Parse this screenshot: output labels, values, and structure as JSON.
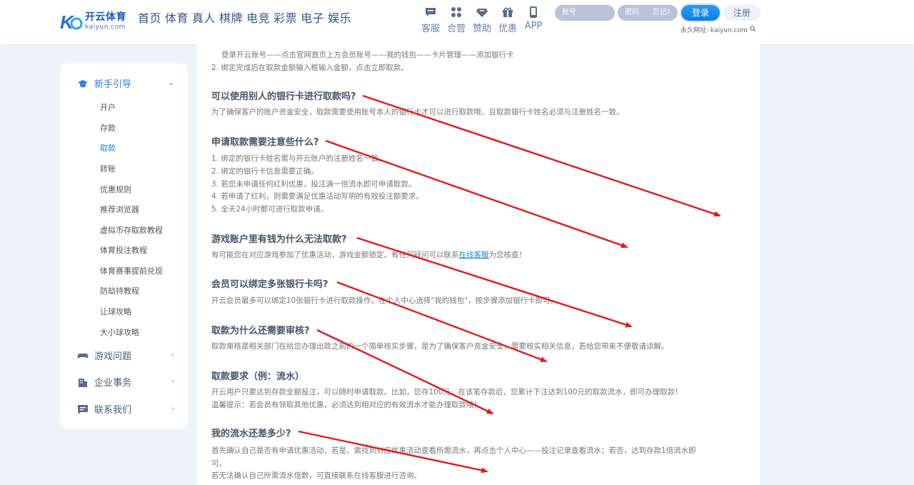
{
  "header": {
    "logo_cn": "开云体育",
    "logo_en": "kaiyun.com",
    "nav": [
      "首页",
      "体育",
      "真人",
      "棋牌",
      "电竞",
      "彩票",
      "电子",
      "娱乐"
    ],
    "quick": [
      {
        "label": "客服",
        "icon": "chat-icon"
      },
      {
        "label": "合营",
        "icon": "grid-icon"
      },
      {
        "label": "赞助",
        "icon": "diamond-icon"
      },
      {
        "label": "优惠",
        "icon": "gift-icon"
      },
      {
        "label": "APP",
        "icon": "phone-icon"
      }
    ],
    "login": {
      "account_placeholder": "账号",
      "password_placeholder": "密码",
      "forgot": "忘记?",
      "login_label": "登录",
      "register_label": "注册",
      "url_text": "永久网址: kaiyun.com"
    }
  },
  "sidebar": {
    "sections": [
      {
        "label": "新手引导",
        "icon": "graduation-cap-icon",
        "expanded": true
      },
      {
        "label": "游戏问题",
        "icon": "gamepad-icon",
        "expanded": false
      },
      {
        "label": "企业事务",
        "icon": "building-icon",
        "expanded": false
      },
      {
        "label": "联系我们",
        "icon": "message-icon",
        "expanded": false
      }
    ],
    "subitems": [
      "开户",
      "存款",
      "取款",
      "转账",
      "优惠规则",
      "推荐浏览器",
      "虚拟币存取款教程",
      "体育投注教程",
      "体育赛事提前兑现",
      "防劫持教程",
      "让球攻略",
      "大小球攻略"
    ],
    "active_subitem": "取款"
  },
  "content": {
    "intro": [
      "登录开云账号——点击官网首页上方会员账号——我的钱包——卡片管理——添加银行卡",
      "2. 绑定完成后在取款金额输入框输入金额，点击立即取款。"
    ],
    "sections": [
      {
        "title": "可以使用别人的银行卡进行取款吗?",
        "lines": [
          "为了确保客户的账户资金安全，取款需要使用账号本人的银行卡才可以进行取款哦，且取款银行卡姓名必须与注册姓名一致。"
        ]
      },
      {
        "title": "申请取款需要注意些什么?",
        "lines": [
          "1. 绑定的银行卡姓名需与开云账户的注册姓名一致。",
          "2. 绑定的银行卡信息需要正确。",
          "3. 若您未申请任何红利优惠，投注满一倍流水即可申请取款。",
          "4. 若申请了红利，则需要满足优惠活动写明的有效投注额要求。",
          "5. 全天24小时都可进行取款申请。"
        ]
      },
      {
        "title": "游戏账户里有钱为什么无法取款?",
        "pre": "有可能您在对应游戏参加了优惠活动，游戏金额锁定。有任何疑问可以联系",
        "link": "在线客服",
        "post": "为您核查！"
      },
      {
        "title": "会员可以绑定多张银行卡吗?",
        "lines": [
          "开云会员最多可以绑定10张银行卡进行取款操作，在个人中心选择\"我的钱包\"，按步骤添加银行卡即可。"
        ]
      },
      {
        "title": "取款为什么还需要审核?",
        "lines": [
          "取款审核是相关部门在给您办理出款之前的一个简单核实步骤，是为了确保客户资金安全，需要核实相关信息，若给您带来不便敬请谅解。"
        ]
      },
      {
        "title": "取款要求（例：流水）",
        "lines": [
          "开云用户只要达到存款全额投注，可以随时申请取款。比如，您存100元，在该笔存款后，您累计下注达到100元的取款流水，即可办理取款！",
          "温馨提示：若会员有领取其他优惠，必须达到相对应的有效流水才能办理取款哦！"
        ]
      },
      {
        "title": "我的流水还差多少?",
        "lines": [
          "首先确认自己是否有申请优惠活动，若是，需找到对应优惠活动查看所需流水，再点击个人中心——投注记录查看流水；若否，达到存款1倍流水即",
          "可。",
          "若无法确认自己所需流水倍数，可直接联系在线客服进行咨询。"
        ]
      }
    ]
  },
  "colors": {
    "accent": "#2b7fe3",
    "arrow": "#e3191c",
    "nav": "#3b5488"
  }
}
